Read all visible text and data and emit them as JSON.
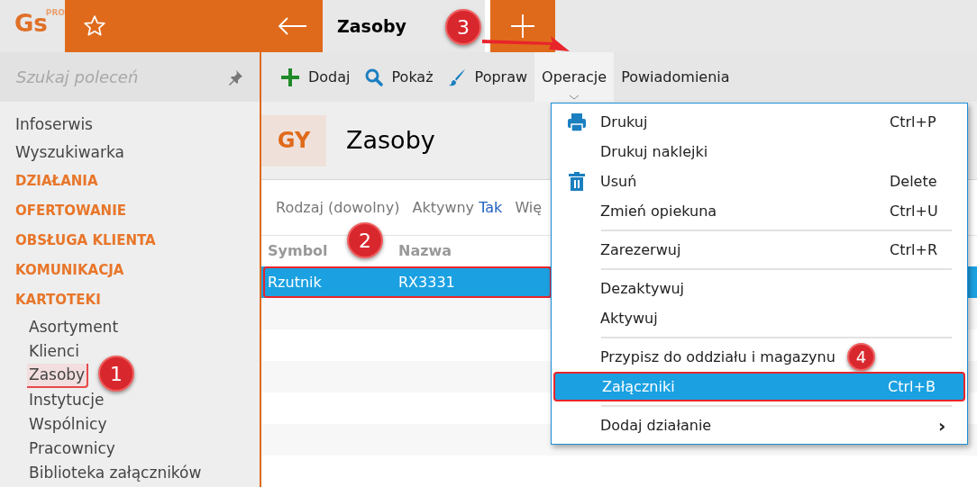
{
  "logo": {
    "text": "Gs",
    "superscript": "PRO"
  },
  "tabs": [
    {
      "label": "Zasoby",
      "selected": true
    }
  ],
  "search": {
    "placeholder": "Szukaj poleceń"
  },
  "sidebar": {
    "items": [
      {
        "kind": "link",
        "label": "Infoserwis"
      },
      {
        "kind": "link",
        "label": "Wyszukiwarka"
      },
      {
        "kind": "section",
        "label": "DZIAŁANIA"
      },
      {
        "kind": "section",
        "label": "OFERTOWANIE"
      },
      {
        "kind": "section",
        "label": "OBSŁUGA KLIENTA"
      },
      {
        "kind": "section",
        "label": "KOMUNIKACJA"
      },
      {
        "kind": "section",
        "label": "KARTOTEKI"
      },
      {
        "kind": "subitem",
        "label": "Asortyment",
        "selected": false
      },
      {
        "kind": "subitem",
        "label": "Klienci",
        "selected": false
      },
      {
        "kind": "subitem",
        "label": "Zasoby",
        "selected": true
      },
      {
        "kind": "subitem",
        "label": "Instytucje",
        "selected": false
      },
      {
        "kind": "subitem",
        "label": "Wspólnicy",
        "selected": false
      },
      {
        "kind": "subitem",
        "label": "Pracownicy",
        "selected": false
      },
      {
        "kind": "subitem",
        "label": "Biblioteka załączników",
        "selected": false
      }
    ]
  },
  "toolbar": [
    {
      "kind": "add",
      "label": "Dodaj",
      "selected": false
    },
    {
      "kind": "show",
      "label": "Pokaż",
      "selected": false
    },
    {
      "kind": "edit",
      "label": "Popraw",
      "selected": false
    },
    {
      "kind": "menu",
      "label": "Operacje",
      "selected": true
    },
    {
      "kind": "plain",
      "label": "Powiadomienia",
      "selected": false
    }
  ],
  "header": {
    "badge": "GY",
    "title": "Zasoby"
  },
  "filters": [
    {
      "label": "Rodzaj (dowolny)"
    },
    {
      "label": "Aktywny",
      "value": "Tak"
    },
    {
      "label": "Wię"
    }
  ],
  "table": {
    "columns": [
      "Symbol",
      "Nazwa"
    ],
    "rows": [
      {
        "cells": [
          "Rzutnik",
          "RX3331"
        ],
        "selected": true
      }
    ]
  },
  "menu": {
    "items": [
      {
        "kind": "print",
        "label": "Drukuj",
        "shortcut": "Ctrl+P",
        "separator": false,
        "selected": false
      },
      {
        "kind": "plain",
        "label": "Drukuj naklejki",
        "separator": false,
        "selected": false
      },
      {
        "kind": "delete",
        "label": "Usuń",
        "shortcut": "Delete",
        "separator": false,
        "selected": false
      },
      {
        "kind": "plain",
        "label": "Zmień opiekuna",
        "shortcut": "Ctrl+U",
        "separator": false,
        "selected": false
      },
      {
        "kind": "plain",
        "label": "Zarezerwuj",
        "shortcut": "Ctrl+R",
        "separator": true,
        "selected": false
      },
      {
        "kind": "plain",
        "label": "Dezaktywuj",
        "separator": true,
        "selected": false
      },
      {
        "kind": "plain",
        "label": "Aktywuj",
        "separator": false,
        "selected": false
      },
      {
        "kind": "plain",
        "label": "Przypisz do oddziału i magazynu",
        "separator": true,
        "selected": false,
        "callout": "4"
      },
      {
        "kind": "plain",
        "label": "Załączniki",
        "shortcut": "Ctrl+B",
        "separator": false,
        "selected": true
      },
      {
        "kind": "plain",
        "label": "Dodaj działanie",
        "submenu": "›",
        "separator": true,
        "selected": false
      }
    ]
  },
  "callouts": [
    "1",
    "2",
    "3"
  ]
}
